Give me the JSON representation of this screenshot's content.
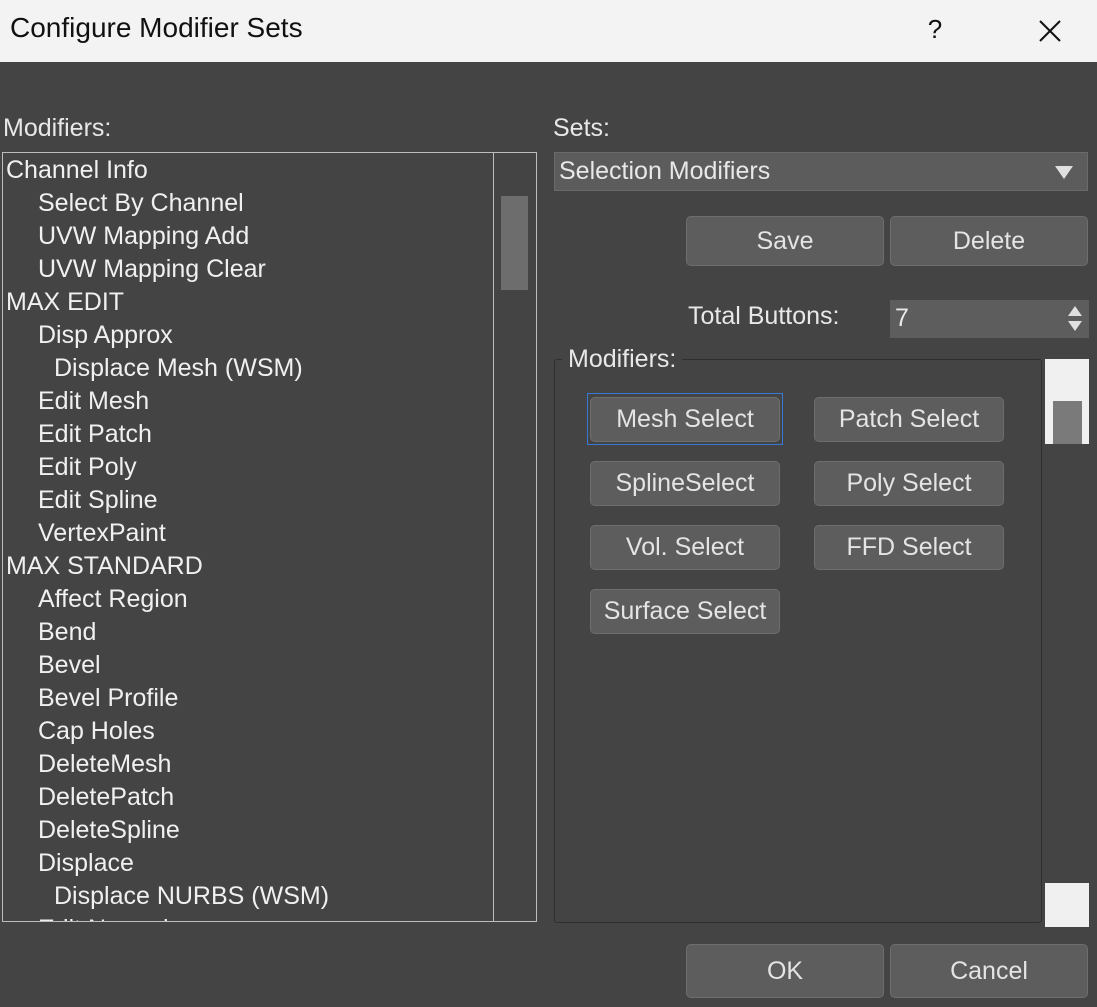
{
  "window": {
    "title": "Configure Modifier Sets",
    "help_label": "?",
    "close_icon": "close-icon"
  },
  "modifiers_list": {
    "label": "Modifiers:",
    "items": [
      {
        "text": "Channel Info",
        "indent": 0
      },
      {
        "text": "Select By Channel",
        "indent": 1
      },
      {
        "text": "UVW Mapping Add",
        "indent": 1
      },
      {
        "text": "UVW Mapping Clear",
        "indent": 1
      },
      {
        "text": "MAX EDIT",
        "indent": 0
      },
      {
        "text": "Disp Approx",
        "indent": 1
      },
      {
        "text": "Displace Mesh (WSM)",
        "indent": 2
      },
      {
        "text": "Edit Mesh",
        "indent": 1
      },
      {
        "text": "Edit Patch",
        "indent": 1
      },
      {
        "text": "Edit Poly",
        "indent": 1
      },
      {
        "text": "Edit Spline",
        "indent": 1
      },
      {
        "text": "VertexPaint",
        "indent": 1
      },
      {
        "text": "MAX STANDARD",
        "indent": 0
      },
      {
        "text": "Affect Region",
        "indent": 1
      },
      {
        "text": "Bend",
        "indent": 1
      },
      {
        "text": "Bevel",
        "indent": 1
      },
      {
        "text": "Bevel Profile",
        "indent": 1
      },
      {
        "text": "Cap Holes",
        "indent": 1
      },
      {
        "text": "DeleteMesh",
        "indent": 1
      },
      {
        "text": "DeletePatch",
        "indent": 1
      },
      {
        "text": "DeleteSpline",
        "indent": 1
      },
      {
        "text": "Displace",
        "indent": 1
      },
      {
        "text": "Displace NURBS (WSM)",
        "indent": 2
      },
      {
        "text": "Edit Normals",
        "indent": 1
      }
    ]
  },
  "sets": {
    "label": "Sets:",
    "selected": "Selection Modifiers",
    "save_label": "Save",
    "delete_label": "Delete"
  },
  "total_buttons": {
    "label": "Total Buttons:",
    "value": "7"
  },
  "modifiers_group": {
    "label": "Modifiers:",
    "buttons": [
      "Mesh Select",
      "Patch Select",
      "SplineSelect",
      "Poly Select",
      "Vol. Select",
      "FFD Select",
      "Surface Select"
    ]
  },
  "footer": {
    "ok_label": "OK",
    "cancel_label": "Cancel"
  },
  "colors": {
    "dialog_bg": "#444444",
    "titlebar_bg": "#f3f3f3",
    "button_bg": "#5d5d5d",
    "focus": "#3a78d4"
  }
}
